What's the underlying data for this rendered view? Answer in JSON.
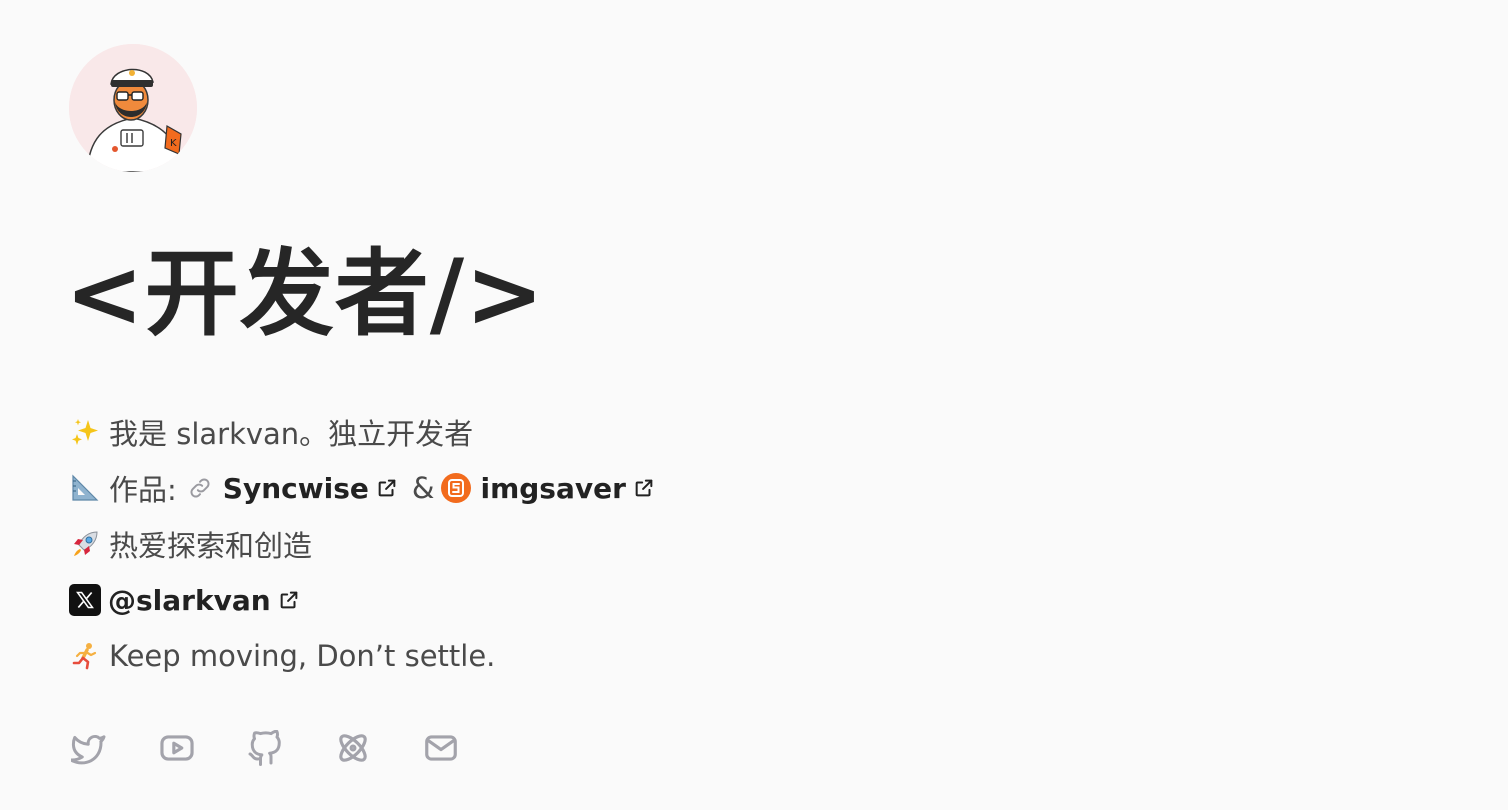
{
  "profile": {
    "title": "<开发者/>"
  },
  "bio": {
    "line1": "我是 slarkvan。独立开发者",
    "line2_prefix": "作品:",
    "project1": "Syncwise",
    "amp": "&",
    "project2": "imgsaver",
    "line3": "热爱探索和创造",
    "twitter_handle": "@slarkvan",
    "line5": "Keep moving, Don’t settle."
  },
  "icons": {
    "line1": "sparkles-icon",
    "line2": "triangular-ruler-icon",
    "line3": "rocket-icon",
    "line5": "running-person-icon",
    "socials": [
      "twitter-icon",
      "youtube-icon",
      "github-icon",
      "atom-icon",
      "mail-icon"
    ]
  },
  "colors": {
    "background": "#fafafa",
    "title": "#262626",
    "text": "#4a4a4a",
    "social_icon": "#a3a3ab",
    "imgsaver_logo": "#f26b1d"
  }
}
